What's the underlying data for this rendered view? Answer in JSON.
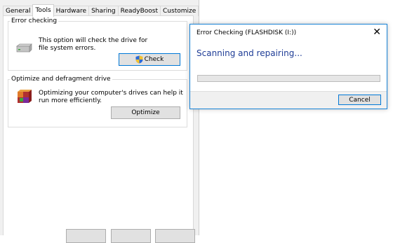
{
  "properties": {
    "tabs": [
      {
        "label": "General"
      },
      {
        "label": "Tools"
      },
      {
        "label": "Hardware"
      },
      {
        "label": "Sharing"
      },
      {
        "label": "ReadyBoost"
      },
      {
        "label": "Customize"
      }
    ],
    "active_tab": "Tools",
    "error_checking": {
      "legend": "Error checking",
      "description": "This option will check the drive for file system errors.",
      "button_label": "Check",
      "icon": "drive-icon",
      "button_icon": "uac-shield-icon"
    },
    "optimize": {
      "legend": "Optimize and defragment drive",
      "description": "Optimizing your computer's drives can help it run more efficiently.",
      "button_label": "Optimize",
      "icon": "defrag-icon"
    }
  },
  "dialog": {
    "title": "Error Checking (FLASHDISK (I:))",
    "close_glyph": "✕",
    "heading": "Scanning and repairing...",
    "progress": 0,
    "cancel_label": "Cancel"
  },
  "colors": {
    "accent_border": "#0078d7",
    "heading": "#1e3c96",
    "progress_fill": "#06b025"
  }
}
